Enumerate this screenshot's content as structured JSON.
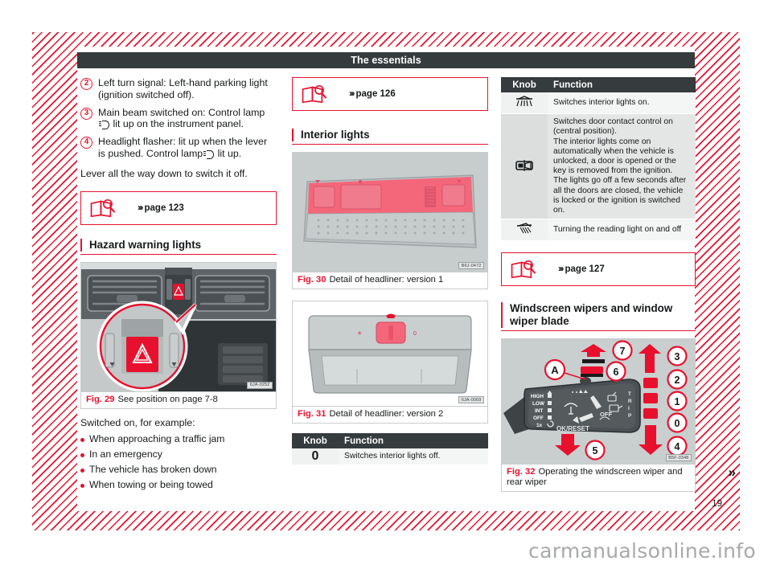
{
  "header": {
    "title": "The essentials"
  },
  "page": {
    "number": "19",
    "watermark": "carmanualsonline.info",
    "next_chevron": "»"
  },
  "left_column": {
    "items": [
      {
        "num": "2",
        "text_before": "Left turn signal: Left-hand parking light (ignition switched off).",
        "text_after": "",
        "has_lamp": false
      },
      {
        "num": "3",
        "text_before": "Main beam switched on: Control lamp",
        "text_after": " lit up on the instrument panel.",
        "has_lamp": true
      },
      {
        "num": "4",
        "text_before": "Headlight flasher: lit up when the lever is pushed. Control lamp",
        "text_after": " lit up.",
        "has_lamp": true
      }
    ],
    "paragraph": "Lever all the way down to switch it off.",
    "reference": {
      "arrows": "›››",
      "label": "page 123"
    },
    "section_heading": "Hazard warning lights",
    "figure": {
      "number": "Fig. 29",
      "caption": "See position on page 7-8",
      "code": "6JA-0252"
    },
    "intro": "Switched on, for example:",
    "bullets": [
      "When approaching a traffic jam",
      "In an emergency",
      "The vehicle has broken down",
      "When towing or being towed"
    ]
  },
  "mid_column": {
    "reference": {
      "arrows": "›››",
      "label": "page 126"
    },
    "section_heading": "Interior lights",
    "figure_30": {
      "number": "Fig. 30",
      "caption": "Detail of headliner: version 1",
      "code": "B6J-0472"
    },
    "figure_31": {
      "number": "Fig. 31",
      "caption": "Detail of headliner: version 2",
      "code": "6JA-0069"
    },
    "table": {
      "headers": {
        "knob": "Knob",
        "function": "Function"
      },
      "rows": [
        {
          "knob": "0",
          "function": "Switches interior lights off."
        }
      ]
    }
  },
  "right_column": {
    "table": {
      "headers": {
        "knob": "Knob",
        "function": "Function"
      },
      "rows": [
        {
          "icon": "dome-light-icon",
          "function": "Switches interior lights on."
        },
        {
          "icon": "door-contact-icon",
          "function": "Switches door contact control on (central position).\nThe interior lights come on automatically when the vehicle is unlocked, a door is opened or the key is removed from the ignition.\nThe lights go off a few seconds after all the doors are closed, the vehicle is locked or the ignition is switched on."
        },
        {
          "icon": "reading-light-icon",
          "function": "Turning the reading light on and off"
        }
      ]
    },
    "reference": {
      "arrows": "›››",
      "label": "page 127"
    },
    "section_heading": "Windscreen wipers and window wiper blade",
    "figure_32": {
      "number": "Fig. 32",
      "caption": "Operating the windscreen wiper and rear wiper",
      "code": "B5F-0348",
      "stalk_labels": [
        "HIGH",
        "LOW",
        "INT",
        "OFF",
        "1x"
      ],
      "reset_label": "OK/RESET",
      "trip_label": "TRIP",
      "off_label": "OFF",
      "callouts": [
        "A",
        "7",
        "6",
        "3",
        "2",
        "1",
        "0",
        "4",
        "5"
      ]
    }
  },
  "colors": {
    "accent_red": "#e8112d",
    "header_dark": "#363b3d",
    "text": "#16191a"
  }
}
